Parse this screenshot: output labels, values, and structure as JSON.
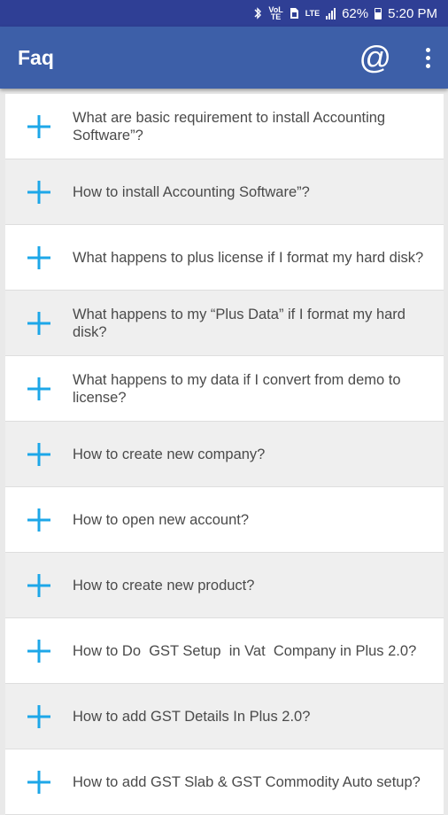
{
  "status_bar": {
    "battery": "62%",
    "time": "5:20 PM",
    "icons": [
      "bluetooth-icon",
      "volte-icon",
      "sim-icon",
      "lte-icon",
      "signal-icon",
      "battery-icon"
    ]
  },
  "app_bar": {
    "title": "Faq",
    "email_icon": "@",
    "menu_icon": "more-vert-icon"
  },
  "faq": {
    "expand_icon": "plus-icon",
    "accent_color": "#1da7e8",
    "items": [
      {
        "question": "What are basic requirement to install Accounting Software”?"
      },
      {
        "question": "How to install Accounting Software”?"
      },
      {
        "question": "What happens to plus license if I format my hard disk?"
      },
      {
        "question": "What happens to my “Plus Data” if I format my hard disk?"
      },
      {
        "question": "What happens to my data if I convert from demo to license?"
      },
      {
        "question": "How to create new company?"
      },
      {
        "question": "How to open new account?"
      },
      {
        "question": "How to create new product?"
      },
      {
        "question": "How to Do  GST Setup  in Vat  Company in Plus 2.0?"
      },
      {
        "question": "How to add GST Details In Plus 2.0?"
      },
      {
        "question": "How to add GST Slab & GST Commodity Auto setup?"
      }
    ]
  }
}
